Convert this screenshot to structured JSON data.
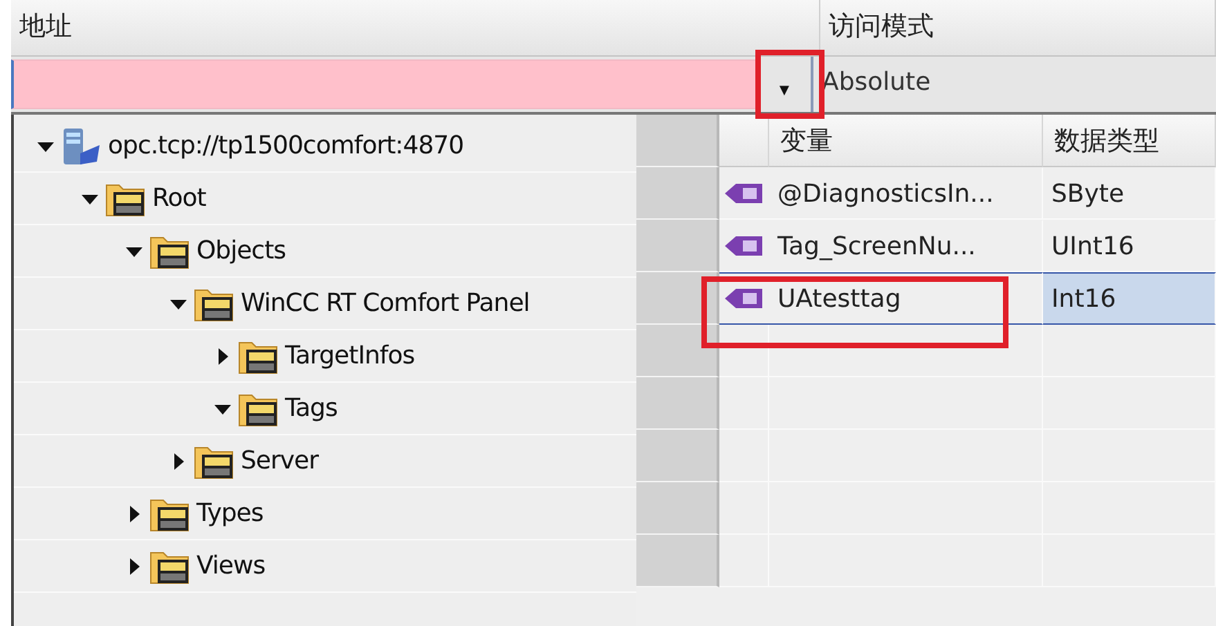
{
  "header": {
    "address_label": "地址",
    "access_mode_label": "访问模式"
  },
  "address_field": {
    "invalid": true
  },
  "dropdown": {
    "glyph": "▼",
    "highlighted": true
  },
  "access_mode": {
    "value": "Absolute"
  },
  "tree": [
    {
      "label": "opc.tcp://tp1500comfort:4870",
      "kind": "server",
      "expanded": true,
      "children": [
        {
          "label": "Root",
          "kind": "folder",
          "expanded": true,
          "children": [
            {
              "label": "Objects",
              "kind": "folder",
              "expanded": true,
              "children": [
                {
                  "label": "WinCC RT Comfort Panel",
                  "kind": "folder",
                  "expanded": true,
                  "children": [
                    {
                      "label": "TargetInfos",
                      "kind": "folder",
                      "expanded": false
                    },
                    {
                      "label": "Tags",
                      "kind": "folder",
                      "expanded": true
                    }
                  ]
                },
                {
                  "label": "Server",
                  "kind": "folder",
                  "expanded": false
                }
              ]
            },
            {
              "label": "Types",
              "kind": "folder",
              "expanded": false
            },
            {
              "label": "Views",
              "kind": "folder",
              "expanded": false
            }
          ]
        }
      ]
    }
  ],
  "table": {
    "columns": [
      "变量",
      "数据类型"
    ],
    "rows": [
      {
        "name": "@DiagnosticsIn...",
        "type": "SByte",
        "selected": false,
        "highlighted": false
      },
      {
        "name": "Tag_ScreenNu...",
        "type": "UInt16",
        "selected": false,
        "highlighted": false
      },
      {
        "name": "UAtesttag",
        "type": "Int16",
        "selected": true,
        "highlighted": true
      }
    ]
  }
}
